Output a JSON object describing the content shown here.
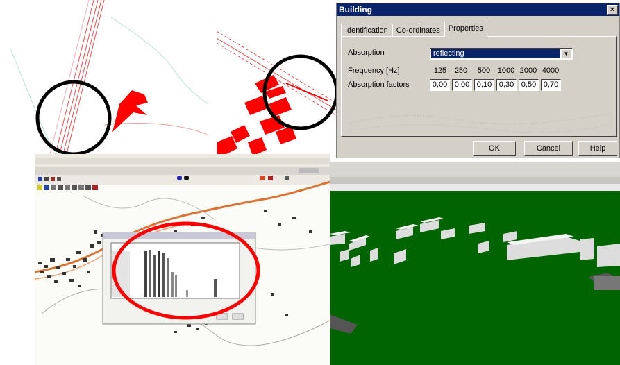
{
  "dialog": {
    "title": "Building",
    "close_glyph": "×",
    "tabs": [
      {
        "label": "Identification",
        "active": false
      },
      {
        "label": "Co-ordinates",
        "active": false
      },
      {
        "label": "Properties",
        "active": true
      }
    ],
    "absorption_label": "Absorption",
    "absorption_value": "reflecting",
    "frequency_label": "Frequency [Hz]",
    "frequencies": [
      "125",
      "250",
      "500",
      "1000",
      "2000",
      "4000"
    ],
    "factors_label": "Absorption factors",
    "factors": [
      "0,00",
      "0,00",
      "0,10",
      "0,30",
      "0,50",
      "0,70"
    ],
    "buttons": {
      "ok": "OK",
      "cancel": "Cancel",
      "help": "Help"
    }
  },
  "colors": {
    "map_red": "#ff0000",
    "highlight_circle": "#ff0000",
    "detail_circle": "#000000",
    "terrain_green": "#006400",
    "title_bar": "#0a246a"
  },
  "icons": {
    "dropdown": "chevron-down-icon",
    "close": "close-icon"
  }
}
